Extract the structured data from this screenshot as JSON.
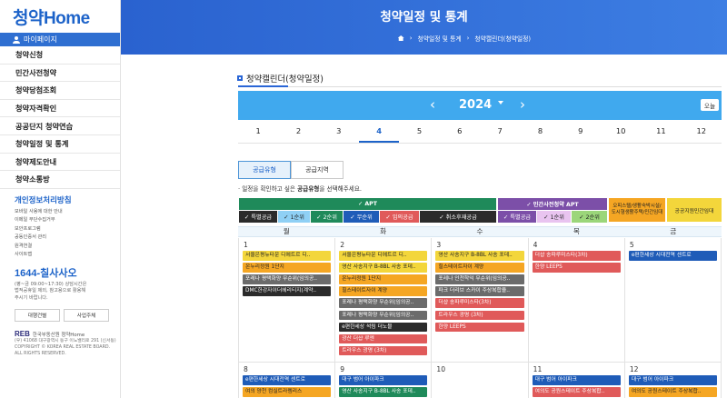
{
  "sidebar": {
    "logo": "청약Home",
    "mypage": "마이페이지",
    "menu": [
      "청약신청",
      "민간사전청약",
      "청약당첨조회",
      "청약자격확인",
      "공공단지 청약연습",
      "청약일정 및 통계",
      "청약제도안내",
      "청약소통방"
    ],
    "privacy_title": "개인정보처리방침",
    "links": [
      "모바일 사용에 대한 안내",
      "이메일 무단수집거부",
      "보안프로그램",
      "공동인증서 관리",
      "원격연결",
      "사이트맵"
    ],
    "phone": "1644-칠사사오",
    "hours": [
      "(평~금 09:00~17:30) 상담시간은",
      "법적공휴일 제외, 참고용으로 활용해",
      "주시기 바랍니다."
    ],
    "btn_rep": "대행건별",
    "btn_biz": "사업주체",
    "reb_logo": "REB",
    "reb_text": "한국부동산원 청약Home",
    "copyright": [
      "(우) 41068 대구광역시 동구 이노밸리로 291 (신서동)",
      "COPYRIGHT © KOREA REAL ESTATE BOARD.",
      "ALL RIGHTS RESERVED."
    ]
  },
  "header": {
    "title": "청약일정 및 통계",
    "breadcrumb": [
      "청약일정 및 통계",
      "청약캘린더(청약일정)"
    ]
  },
  "main": {
    "section_title": "청약캘린더(청약일정)",
    "year": "2024",
    "today": "오늘",
    "months": [
      "1",
      "2",
      "3",
      "4",
      "5",
      "6",
      "7",
      "8",
      "9",
      "10",
      "11",
      "12"
    ],
    "active_month": "4",
    "tabs": [
      "공급유형",
      "공급지역"
    ],
    "notice_prefix": "· 일정을 확인하고 싶은 ",
    "notice_bold": "공급유형",
    "notice_suffix": "을 선택해주세요.",
    "filters": {
      "apt": "✓ APT",
      "private_pre": "✓ 민간사전청약 APT",
      "officetel": "오피스텔/생활숙박시설/도시형생활주택/민간임대",
      "public": "공공지원민간임대",
      "chips": [
        "특별공급",
        "1순위",
        "2순위",
        "무순위",
        "임의공급",
        "취소후재공급",
        "특별공급",
        "1순위",
        "2순위"
      ]
    },
    "dow": [
      "월",
      "화",
      "수",
      "목",
      "금"
    ],
    "week1": {
      "days": [
        "1",
        "2",
        "3",
        "4",
        "5"
      ],
      "mon": [
        "서울은평뉴타운 디에트르 디..",
        "온누리정원 1단지",
        "포레나 평택화양 무순위(임의공..",
        "DMC한강자이더헤리티지(계약.."
      ],
      "tue": [
        "서울은평뉴타운 디에트르 디..",
        "영산 사송지구 B-8BL 사송 포데..",
        "온누리정원 1단지",
        "힐스테이트자이 계양",
        "포레나 평택화양 무순위(임의공..",
        "포레나 평택화양 무순위(임의공..",
        "e편한세상 석림 더노블",
        "광산 더샵 루엔",
        "트라우스 광명 (3차)"
      ],
      "wed": [
        "영산 사송지구 B-8BL 사송 포데..",
        "힐스테이트자이 계양",
        "포레나 인천학익 무순위(임의공..",
        "파크 더리브 스카이 주상복합을..",
        "더샵 송파루미스타(3차)",
        "트라우스 광명 (3차)",
        "한양 LEEPS"
      ],
      "thu": [
        "더샵 송파루미스타(3차)",
        "한양 LEEPS"
      ],
      "fri": [
        "e편한세상 시대전역 센트로"
      ]
    },
    "week2": {
      "days": [
        "8",
        "9",
        "10",
        "11",
        "12"
      ],
      "mon": [
        "e편한세상 시대전역 센트로",
        "여의 양천 컴실트라렘리스"
      ],
      "tue": [
        "대구 범어 아이파크",
        "영산 사송지구 B-8BL 사송 포데.."
      ],
      "wed": [],
      "thu": [
        "대구 범어 아이파크",
        "여의도 공원스테이트 주상복합.."
      ],
      "fri": [
        "대구 범어 아이파크",
        "여의도 공원스테이트 주상복합.."
      ]
    }
  },
  "colors": {
    "header": "#2a62cf",
    "yearbar": "#40a9ee",
    "apt_green": "#1f8a5a",
    "yellow": "#f3d63b",
    "orange": "#f5a623",
    "red": "#e05a5a",
    "pink": "#e07ac0",
    "purple": "#7c4fa8",
    "dark": "#2b2b2b",
    "blue": "#1f5cb8",
    "gray": "#6b6b6b",
    "skyblue": "#8fd0f5",
    "lightgreen": "#9bd67a"
  }
}
